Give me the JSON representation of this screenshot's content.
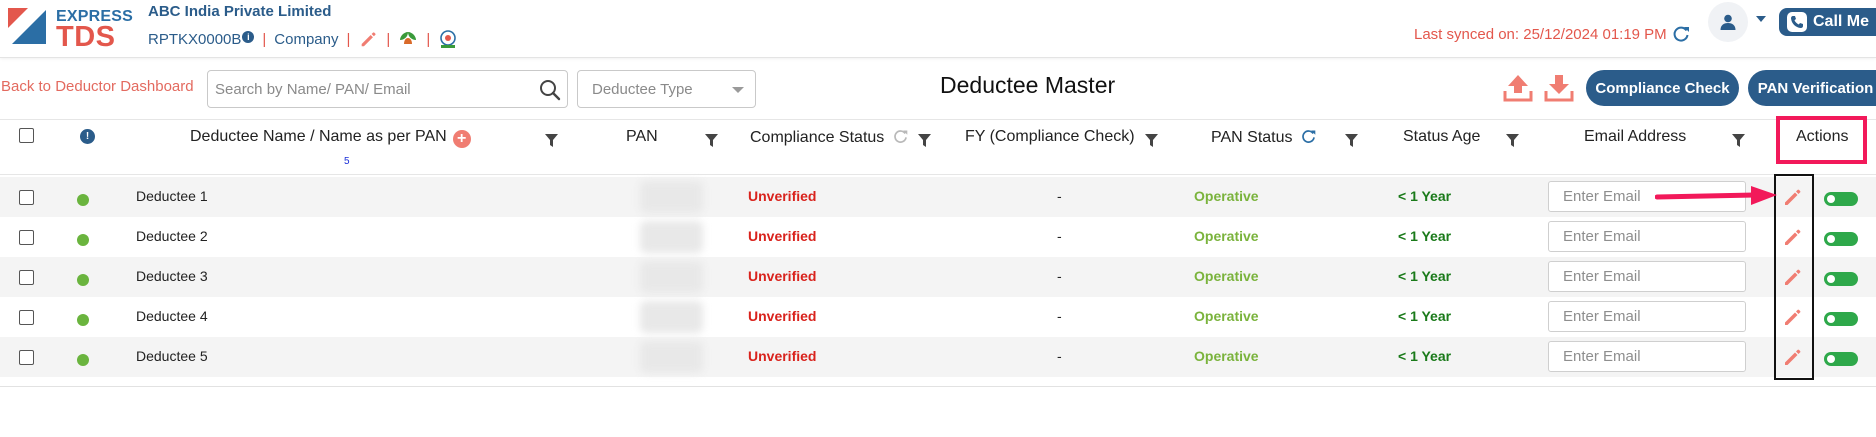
{
  "header": {
    "logo_top": "EXPRESS",
    "logo_bottom": "TDS",
    "company_name": "ABC India Private Limited",
    "tan": "RPTKX0000B",
    "tan_info_glyph": "i",
    "separator": "|",
    "company_link": "Company",
    "last_synced": "Last synced on: 25/12/2024 01:19 PM",
    "call_me_label": "Call Me"
  },
  "toolbar": {
    "back_label": "Back to Deductor Dashboard",
    "search_placeholder": "Search by Name/ PAN/ Email",
    "deductee_type_placeholder": "Deductee Type",
    "page_title": "Deductee Master",
    "compliance_check_label": "Compliance Check",
    "pan_verification_label": "PAN Verification"
  },
  "table": {
    "info_glyph": "!",
    "add_glyph": "+",
    "columns": {
      "name": "Deductee Name / Name as per PAN",
      "name_count": "5",
      "pan": "PAN",
      "compliance_status": "Compliance Status",
      "fy": "FY (Compliance Check)",
      "pan_status": "PAN Status",
      "status_age": "Status Age",
      "email": "Email Address",
      "actions": "Actions"
    },
    "email_placeholder": "Enter Email",
    "rows": [
      {
        "name": "Deductee 1",
        "compliance_status": "Unverified",
        "fy": "-",
        "pan_status": "Operative",
        "status_age": "< 1 Year"
      },
      {
        "name": "Deductee 2",
        "compliance_status": "Unverified",
        "fy": "-",
        "pan_status": "Operative",
        "status_age": "< 1 Year"
      },
      {
        "name": "Deductee 3",
        "compliance_status": "Unverified",
        "fy": "-",
        "pan_status": "Operative",
        "status_age": "< 1 Year"
      },
      {
        "name": "Deductee 4",
        "compliance_status": "Unverified",
        "fy": "-",
        "pan_status": "Operative",
        "status_age": "< 1 Year"
      },
      {
        "name": "Deductee 5",
        "compliance_status": "Unverified",
        "fy": "-",
        "pan_status": "Operative",
        "status_age": "< 1 Year"
      }
    ]
  },
  "icons": {
    "logo": "express-tds-logo",
    "edit": "pencil-icon",
    "gst": "leaf-icon",
    "income_tax": "emblem-icon",
    "sync": "refresh-icon",
    "user": "user-icon",
    "phone": "phone-icon",
    "search": "search-icon",
    "upload": "upload-icon",
    "download": "download-icon",
    "filter": "filter-icon",
    "status": "status-dot-icon",
    "toggle": "toggle-icon"
  },
  "colors": {
    "brand_blue": "#2b5c8a",
    "brand_red": "#e3574c",
    "unverified": "#d9221c",
    "operative": "#7ab33c",
    "status_age": "#1a7a1a",
    "toggle_on": "#2ea84a",
    "annotation_pink": "#f2195a",
    "annotation_black": "#111111"
  }
}
